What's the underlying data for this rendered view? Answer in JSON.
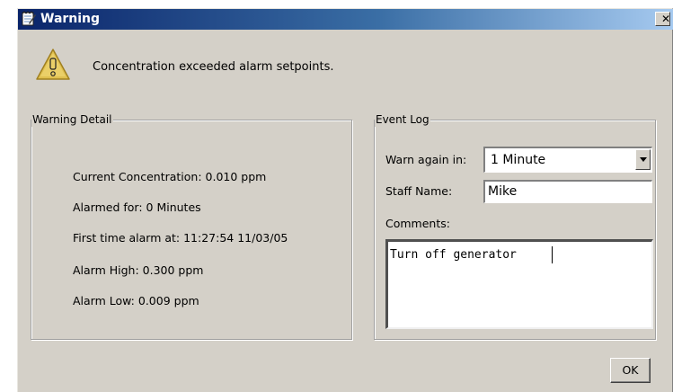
{
  "window": {
    "title": "Warning",
    "close_glyph": "✕",
    "icons": {
      "title": "notebook-app-icon",
      "message": "warning-triangle-icon",
      "close": "close-icon",
      "dropdown": "chevron-down-icon"
    },
    "colors": {
      "titlebar_start": "#0a246a",
      "titlebar_end": "#a6caf0",
      "dialog_bg": "#d4d0c8",
      "warning_yellow": "#e0c050"
    }
  },
  "message": "Concentration exceeded alarm setpoints.",
  "warning_detail": {
    "legend": "Warning Detail",
    "lines": [
      "Current Concentration: 0.010 ppm",
      "Alarmed for: 0 Minutes",
      "First time alarm at: 11:27:54 11/03/05",
      "Alarm High: 0.300 ppm",
      "Alarm Low: 0.009 ppm"
    ]
  },
  "event_log": {
    "legend": "Event Log",
    "warn_again_label": "Warn again in:",
    "warn_again_value": "1 Minute",
    "staff_name_label": "Staff Name:",
    "staff_name_value": "Mike",
    "comments_label": "Comments:",
    "comments_value": "Turn off generator"
  },
  "buttons": {
    "ok": "OK"
  }
}
